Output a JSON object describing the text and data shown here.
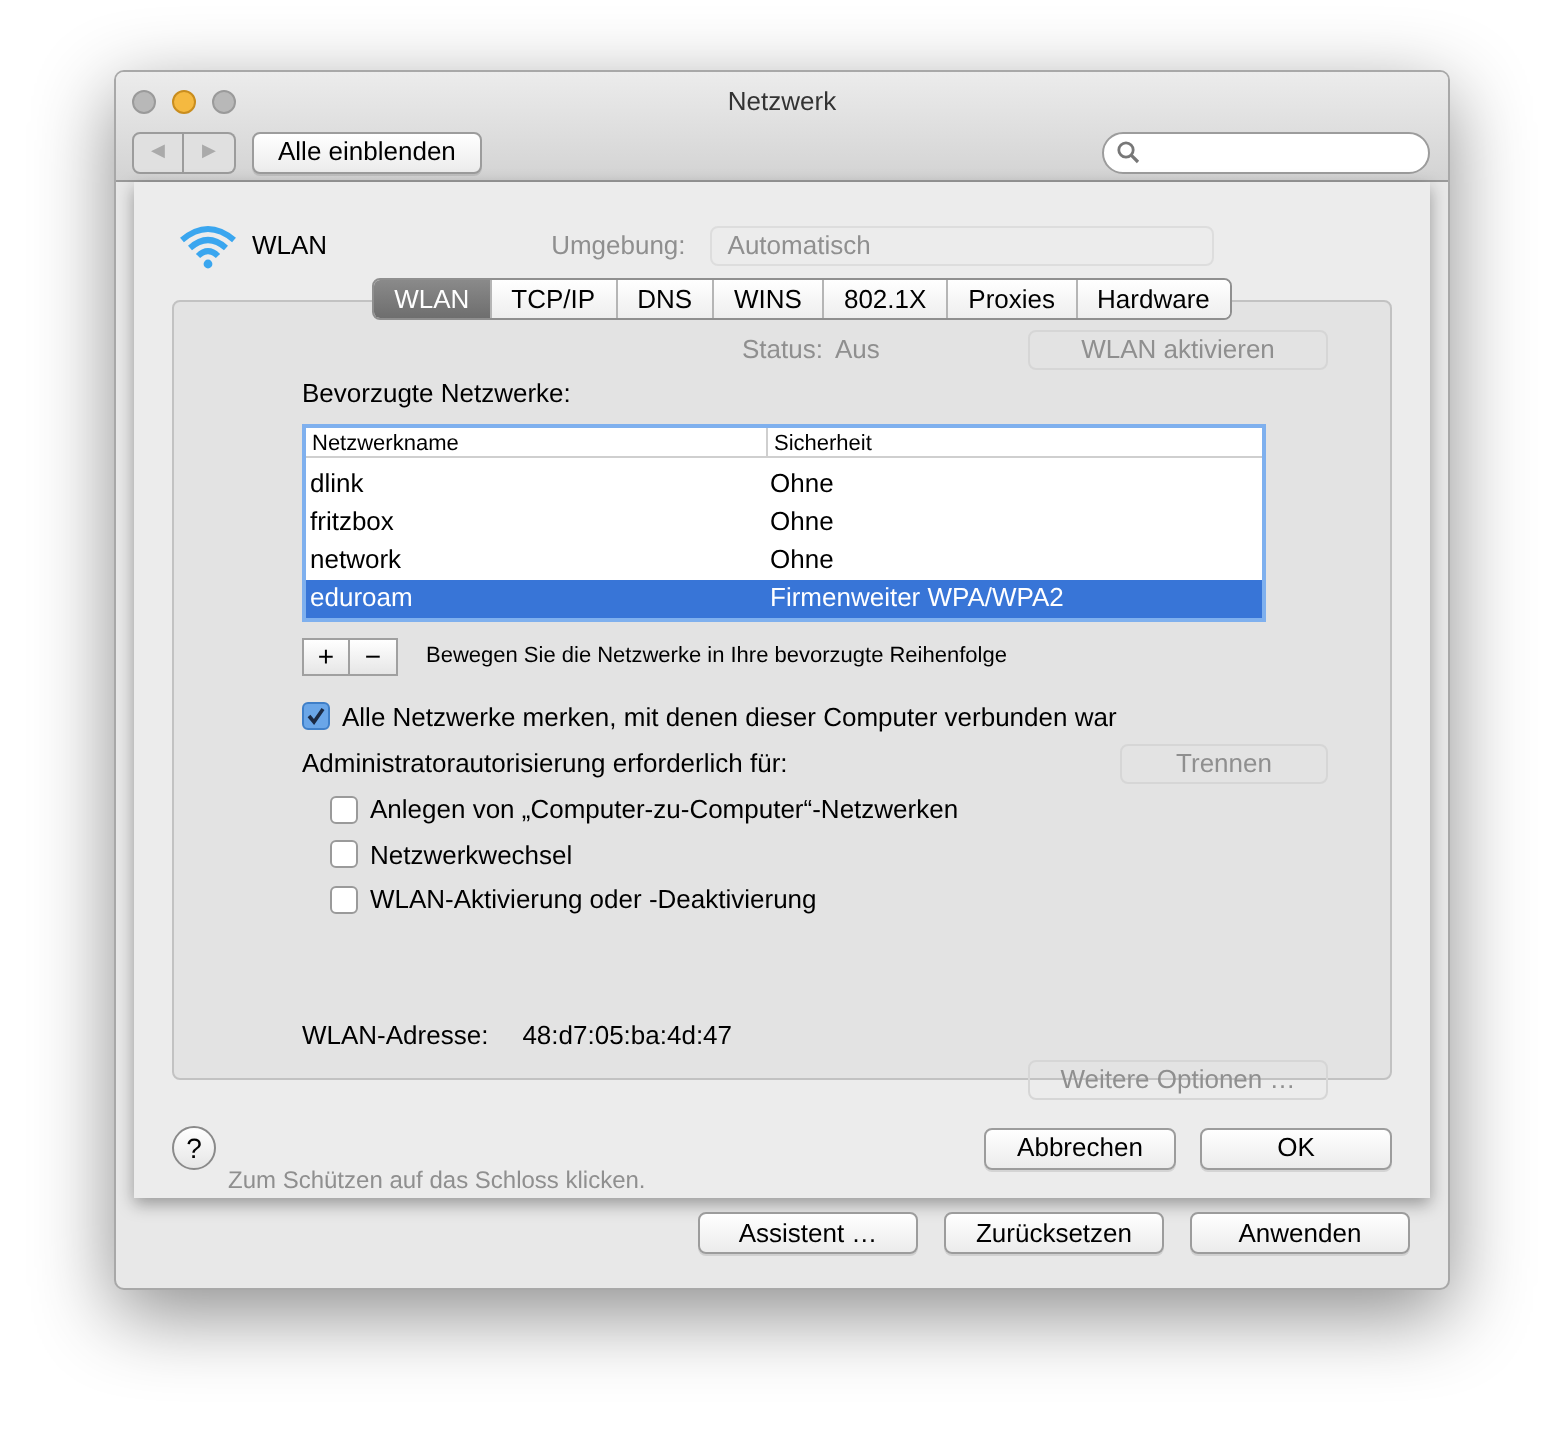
{
  "window": {
    "title": "Netzwerk"
  },
  "toolbar": {
    "back_label": "◀",
    "forward_label": "▶",
    "show_all": "Alle einblenden"
  },
  "service": {
    "name": "WLAN",
    "location_label": "Umgebung:",
    "location_value": "Automatisch"
  },
  "tabs": [
    {
      "label": "WLAN",
      "selected": true
    },
    {
      "label": "TCP/IP",
      "selected": false
    },
    {
      "label": "DNS",
      "selected": false
    },
    {
      "label": "WINS",
      "selected": false
    },
    {
      "label": "802.1X",
      "selected": false
    },
    {
      "label": "Proxies",
      "selected": false
    },
    {
      "label": "Hardware",
      "selected": false
    }
  ],
  "background": {
    "status_label": "Status:",
    "status_value": "Aus",
    "wlan_button": "WLAN aktivieren",
    "disconnect_button": "Trennen",
    "more_button": "Weitere Optionen …",
    "lock_text": "Zum Schützen auf das Schloss klicken."
  },
  "preferred": {
    "title": "Bevorzugte Netzwerke:",
    "columns": [
      "Netzwerkname",
      "Sicherheit"
    ],
    "rows": [
      {
        "name": "dlink",
        "security": "Ohne",
        "selected": false
      },
      {
        "name": "fritzbox",
        "security": "Ohne",
        "selected": false
      },
      {
        "name": "network",
        "security": "Ohne",
        "selected": false
      },
      {
        "name": "eduroam",
        "security": "Firmenweiter WPA/WPA2",
        "selected": true
      }
    ],
    "add": "+",
    "remove": "−",
    "hint": "Bewegen Sie die Netzwerke in Ihre bevorzugte Reihenfolge"
  },
  "remember": {
    "label": "Alle Netzwerke merken, mit denen dieser Computer verbunden war",
    "checked": true
  },
  "admin": {
    "title": "Administratorautorisierung erforderlich für:",
    "options": [
      {
        "label": "Anlegen von „Computer-zu-Computer“-Netzwerken",
        "checked": false
      },
      {
        "label": "Netzwerkwechsel",
        "checked": false
      },
      {
        "label": "WLAN-Aktivierung oder -Deaktivierung",
        "checked": false
      }
    ]
  },
  "address": {
    "label": "WLAN-Adresse:",
    "value": "48:d7:05:ba:4d:47"
  },
  "sheet_buttons": {
    "help": "?",
    "cancel": "Abbrechen",
    "ok": "OK"
  },
  "window_buttons": [
    "Assistent …",
    "Zurücksetzen",
    "Anwenden"
  ]
}
